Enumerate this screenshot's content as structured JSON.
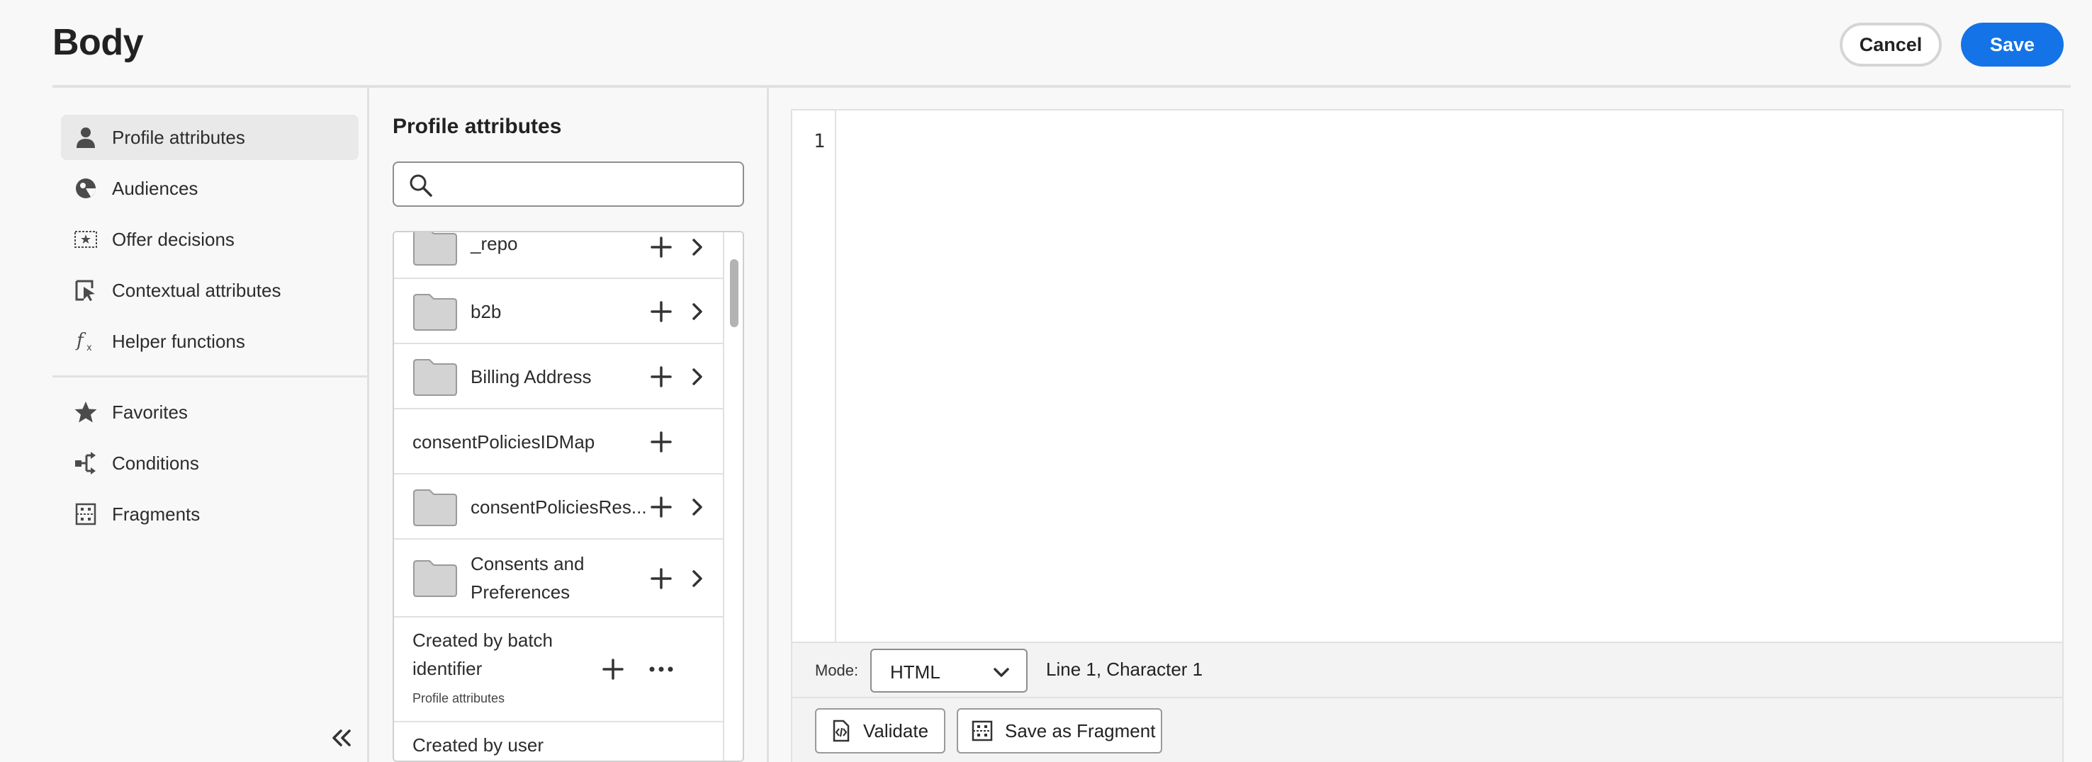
{
  "header": {
    "title": "Body",
    "cancel_label": "Cancel",
    "save_label": "Save"
  },
  "nav": {
    "items": [
      {
        "label": "Profile attributes",
        "icon": "user-icon",
        "active": true
      },
      {
        "label": "Audiences",
        "icon": "audience-icon"
      },
      {
        "label": "Offer decisions",
        "icon": "offer-decision-icon"
      },
      {
        "label": "Contextual attributes",
        "icon": "contextual-icon"
      },
      {
        "label": "Helper functions",
        "icon": "function-icon"
      }
    ],
    "items2": [
      {
        "label": "Favorites",
        "icon": "star-icon"
      },
      {
        "label": "Conditions",
        "icon": "conditions-icon"
      },
      {
        "label": "Fragments",
        "icon": "fragment-icon"
      }
    ]
  },
  "attributes": {
    "title": "Profile attributes",
    "search_placeholder": "",
    "rows": [
      {
        "label": "_repo",
        "folder": true,
        "expandable": true
      },
      {
        "label": "b2b",
        "folder": true,
        "expandable": true
      },
      {
        "label": "Billing Address",
        "folder": true,
        "expandable": true
      },
      {
        "label": "consentPoliciesIDMap",
        "folder": false,
        "expandable": false
      },
      {
        "label": "consentPoliciesRes...",
        "folder": true,
        "expandable": true
      },
      {
        "label_line1": "Consents and",
        "label_line2": "Preferences",
        "folder": true,
        "expandable": true
      },
      {
        "label_line1": "Created by batch",
        "label_line2": "identifier",
        "sublabel": "Profile attributes",
        "folder": false,
        "more": true
      },
      {
        "label": "Created by user",
        "folder": false
      }
    ]
  },
  "editor": {
    "line_number": "1",
    "code": "",
    "mode_label": "Mode:",
    "mode_value": "HTML",
    "cursor_status": "Line 1, Character 1",
    "validate_label": "Validate",
    "save_fragment_label": "Save as Fragment"
  },
  "colors": {
    "accent": "#1473e6",
    "background": "#f8f8f8",
    "divider": "#e1e1e1"
  }
}
